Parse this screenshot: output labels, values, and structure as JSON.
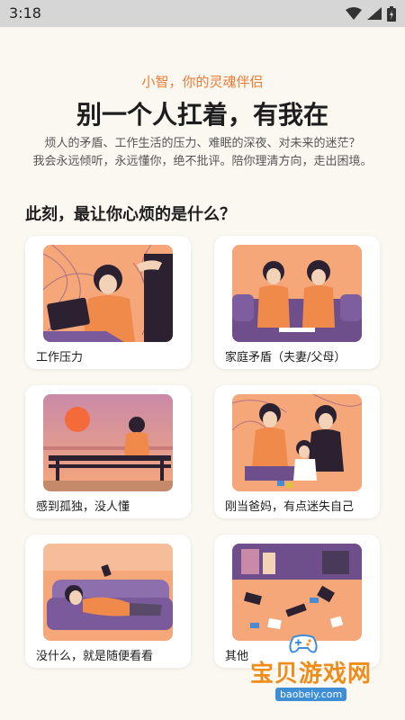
{
  "status_bar": {
    "time": "3:18",
    "icons": [
      "wifi-icon",
      "signal-icon",
      "battery-icon"
    ]
  },
  "header": {
    "subtitle": "小智，你的灵魂伴侣",
    "title": "别一个人扛着，有我在",
    "description_line1": "烦人的矛盾、工作生活的压力、难眠的深夜、对未来的迷茫？",
    "description_line2": "我会永远倾听，永远懂你，绝不批评。陪你理清方向，走出困境。"
  },
  "question": "此刻，最让你心烦的是什么？",
  "options": [
    {
      "label": "工作压力",
      "illustration": "work-stress-illustration"
    },
    {
      "label": "家庭矛盾（夫妻/父母）",
      "illustration": "family-conflict-illustration"
    },
    {
      "label": "感到孤独，没人懂",
      "illustration": "loneliness-illustration"
    },
    {
      "label": "刚当爸妈，有点迷失自己",
      "illustration": "new-parents-illustration"
    },
    {
      "label": "没什么，就是随便看看",
      "illustration": "just-browsing-illustration"
    },
    {
      "label": "其他",
      "illustration": "other-illustration"
    }
  ],
  "watermark": {
    "text": "宝贝游戏网",
    "url": "baobeiy.com"
  },
  "colors": {
    "accent": "#ef7a31",
    "background": "#fbf8f2",
    "card": "#ffffff",
    "illustration_orange": "#f08a4b",
    "illustration_purple": "#6e4f8c"
  }
}
